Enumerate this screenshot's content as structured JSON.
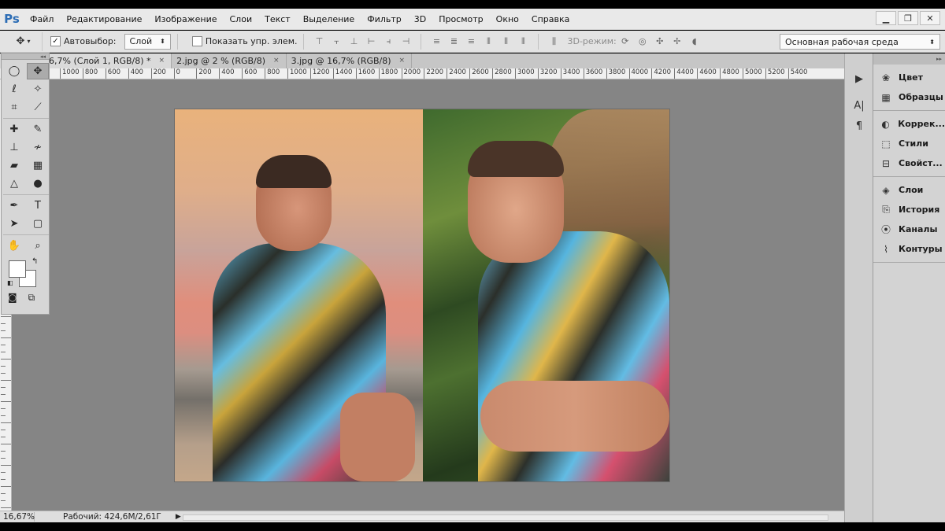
{
  "app": {
    "logo": "Ps",
    "menu": [
      "Файл",
      "Редактирование",
      "Изображение",
      "Слои",
      "Текст",
      "Выделение",
      "Фильтр",
      "3D",
      "Просмотр",
      "Окно",
      "Справка"
    ],
    "window_controls": {
      "minimize": "▁",
      "restore": "❐",
      "close": "✕"
    }
  },
  "options": {
    "tool_icon": "move-tool",
    "autoselect_label": "Автовыбор:",
    "autoselect_checked": "✓",
    "autoselect_target": "Слой",
    "show_controls_label": "Показать упр. элем.",
    "mode3d_label": "3D-режим:",
    "workspace": "Основная рабочая среда"
  },
  "tabs": [
    {
      "label": "6,7% (Слой 1, RGB/8) *",
      "close": "×"
    },
    {
      "label": "2.jpg @ 2 % (RGB/8)",
      "close": "×"
    },
    {
      "label": "3.jpg @ 16,7% (RGB/8)",
      "close": "×"
    }
  ],
  "ruler": {
    "ticks": [
      "1000",
      "800",
      "600",
      "400",
      "200",
      "0",
      "200",
      "400",
      "600",
      "800",
      "1000",
      "1200",
      "1400",
      "1600",
      "1800",
      "2000",
      "2200",
      "2400",
      "2600",
      "2800",
      "3000",
      "3200",
      "3400",
      "3600",
      "3800",
      "4000",
      "4200",
      "4400",
      "4600",
      "4800",
      "5000",
      "5200",
      "5400"
    ]
  },
  "status": {
    "zoom": "16,67%",
    "info": "Рабочий: 424,6M/2,61Г",
    "arrow": "▶"
  },
  "right_panel": {
    "groups": [
      [
        {
          "label": "Цвет",
          "icon": "palette-icon"
        },
        {
          "label": "Образцы",
          "icon": "swatches-icon"
        }
      ],
      [
        {
          "label": "Коррек...",
          "icon": "adjustments-icon"
        },
        {
          "label": "Стили",
          "icon": "styles-icon"
        },
        {
          "label": "Свойст...",
          "icon": "properties-icon"
        }
      ],
      [
        {
          "label": "Слои",
          "icon": "layers-icon"
        },
        {
          "label": "История",
          "icon": "history-icon"
        },
        {
          "label": "Каналы",
          "icon": "channels-icon"
        },
        {
          "label": "Контуры",
          "icon": "paths-icon"
        }
      ]
    ]
  },
  "colors": {
    "foreground": "#ffffff",
    "background": "#ffffff",
    "accent": "#2d6db5"
  }
}
